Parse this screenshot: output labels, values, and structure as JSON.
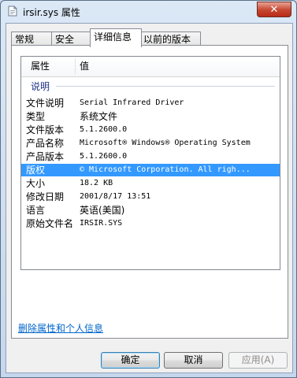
{
  "window": {
    "title": "irsir.sys 属性",
    "close_glyph": "✕"
  },
  "tabs": [
    {
      "label": "常规"
    },
    {
      "label": "安全"
    },
    {
      "label": "详细信息",
      "active": true
    },
    {
      "label": "以前的版本"
    }
  ],
  "details": {
    "columns": {
      "property": "属性",
      "value": "值"
    },
    "group": "说明",
    "rows": [
      {
        "key": "文件说明",
        "value": "Serial Infrared Driver"
      },
      {
        "key": "类型",
        "value": "系统文件"
      },
      {
        "key": "文件版本",
        "value": "5.1.2600.0"
      },
      {
        "key": "产品名称",
        "value": "Microsoft® Windows® Operating System"
      },
      {
        "key": "产品版本",
        "value": "5.1.2600.0"
      },
      {
        "key": "版权",
        "value": "© Microsoft Corporation. All righ...",
        "selected": true
      },
      {
        "key": "大小",
        "value": "18.2 KB"
      },
      {
        "key": "修改日期",
        "value": "2001/8/17 13:51"
      },
      {
        "key": "语言",
        "value": "英语(美国)"
      },
      {
        "key": "原始文件名",
        "value": "IRSIR.SYS"
      }
    ]
  },
  "links": {
    "remove_props": "删除属性和个人信息"
  },
  "buttons": {
    "ok": "确定",
    "cancel": "取消",
    "apply": "应用(A)"
  },
  "icons": {
    "title": "file-icon",
    "close": "close-icon"
  }
}
